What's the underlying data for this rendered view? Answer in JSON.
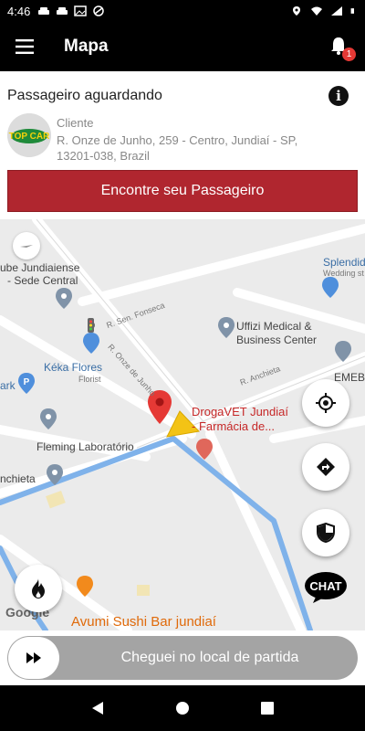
{
  "status_bar": {
    "time": "4:46"
  },
  "app_bar": {
    "title": "Mapa",
    "notification_count": "1"
  },
  "card": {
    "title": "Passageiro aguardando",
    "client_label": "Cliente",
    "client_address": "R. Onze de Junho, 259 - Centro, Jundiaí - SP, 13201-038, Brazil",
    "avatar_text": "TOP CAR",
    "find_button": "Encontre seu Passageiro"
  },
  "map": {
    "labels": {
      "clube": "ube Jundiaiense",
      "sede": "- Sede Central",
      "splendid": "Splendida",
      "wedding": "Wedding st",
      "sen_fonseca": "R. Sen. Fonseca",
      "uffizi1": "Uffizi Medical &",
      "uffizi2": "Business Center",
      "onze": "R. Onze de Junho",
      "keka": "Kéka Flores",
      "florist": "Florist",
      "anchieta_r": "R. Anchieta",
      "emeb": "EMEB",
      "ark": "ark",
      "droga1": "DrogaVET Jundiaí",
      "droga2": "- Farmácia de...",
      "fleming": "Fleming Laboratório",
      "anchieta_l": "nchieta",
      "avumi": "Avumi Sushi Bar jundiaí",
      "google": "Google",
      "chat": "CHAT"
    }
  },
  "slider": {
    "label": "Cheguei no local de partida"
  },
  "colors": {
    "accent_red": "#b0262f",
    "route_blue": "#7fb2ea",
    "app_bar": "#000000",
    "pin_red": "#e53935"
  }
}
